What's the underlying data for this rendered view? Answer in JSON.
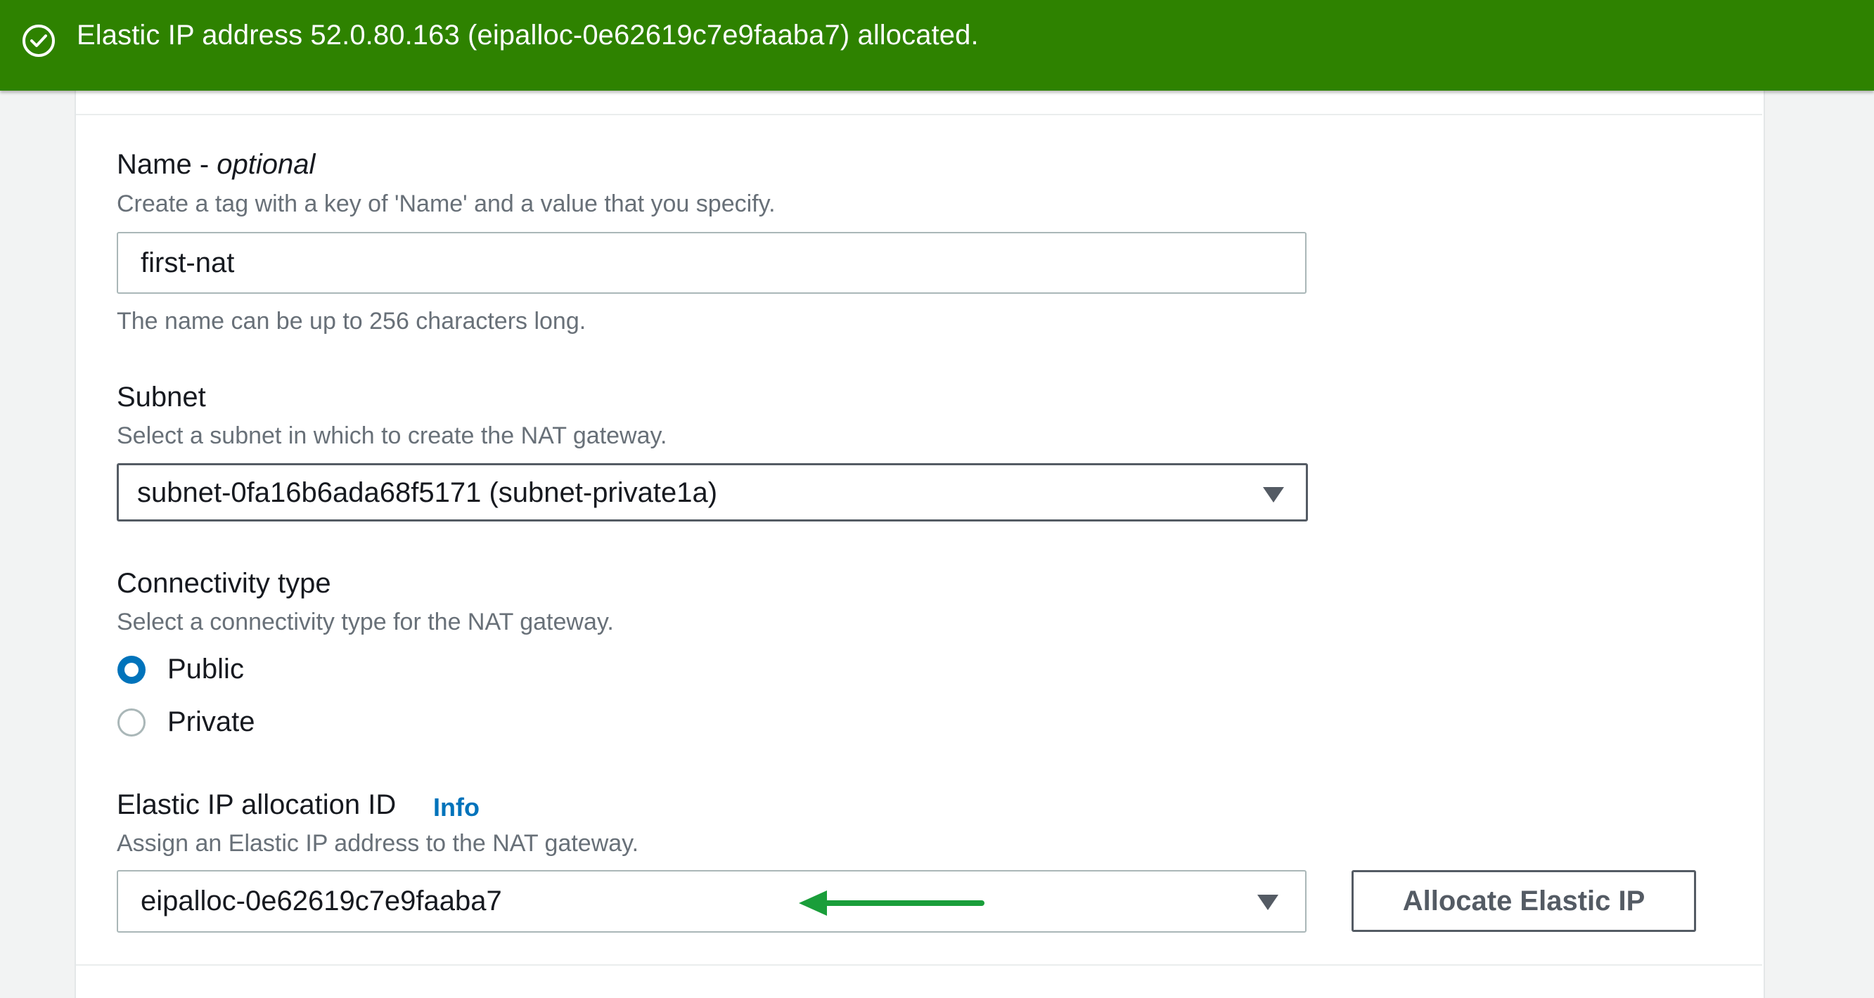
{
  "flash": {
    "message": "Elastic IP address 52.0.80.163 (eipalloc-0e62619c7e9faaba7) allocated.",
    "status": "success",
    "color": "#2e8200",
    "icon": "check-circle-icon"
  },
  "form": {
    "name": {
      "label": "Name - ",
      "label_optional": "optional",
      "description": "Create a tag with a key of 'Name' and a value that you specify.",
      "value": "first-nat",
      "constraint": "The name can be up to 256 characters long."
    },
    "subnet": {
      "label": "Subnet",
      "description": "Select a subnet in which to create the NAT gateway.",
      "selected": "subnet-0fa16b6ada68f5171 (subnet-private1a)"
    },
    "connectivity": {
      "label": "Connectivity type",
      "description": "Select a connectivity type for the NAT gateway.",
      "options": [
        {
          "label": "Public",
          "checked": true
        },
        {
          "label": "Private",
          "checked": false
        }
      ]
    },
    "elastic_ip": {
      "label": "Elastic IP allocation ID",
      "info_link": "Info",
      "description": "Assign an Elastic IP address to the NAT gateway.",
      "selected": "eipalloc-0e62619c7e9faaba7",
      "allocate_button": "Allocate Elastic IP"
    }
  },
  "annotation": {
    "arrow_color": "#1a9e3a",
    "arrow_icon": "left-arrow-icon"
  },
  "colors": {
    "accent": "#0073bb",
    "border": "#aab7b8",
    "text_secondary": "#687078"
  }
}
